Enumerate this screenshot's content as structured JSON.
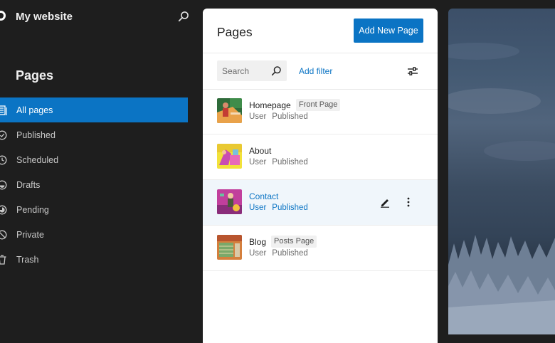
{
  "site": {
    "title": "My website"
  },
  "sidebar": {
    "title": "Pages",
    "items": [
      {
        "label": "All pages",
        "icon": "pages-icon",
        "active": true
      },
      {
        "label": "Published",
        "icon": "published-icon"
      },
      {
        "label": "Scheduled",
        "icon": "scheduled-icon"
      },
      {
        "label": "Drafts",
        "icon": "drafts-icon"
      },
      {
        "label": "Pending",
        "icon": "pending-icon"
      },
      {
        "label": "Private",
        "icon": "private-icon"
      },
      {
        "label": "Trash",
        "icon": "trash-icon"
      }
    ]
  },
  "main": {
    "title": "Pages",
    "add_button": "Add New Page",
    "search": {
      "placeholder": "Search",
      "value": ""
    },
    "add_filter": "Add filter",
    "rows": [
      {
        "title": "Homepage",
        "badge": "Front Page",
        "author": "User",
        "status": "Published"
      },
      {
        "title": "About",
        "badge": "",
        "author": "User",
        "status": "Published"
      },
      {
        "title": "Contact",
        "badge": "",
        "author": "User",
        "status": "Published"
      },
      {
        "title": "Blog",
        "badge": "Posts Page",
        "author": "User",
        "status": "Published"
      }
    ]
  },
  "colors": {
    "accent": "#0b74c4",
    "sidebar_bg": "#1e1e1e",
    "highlight_row": "#f0f6fb"
  }
}
